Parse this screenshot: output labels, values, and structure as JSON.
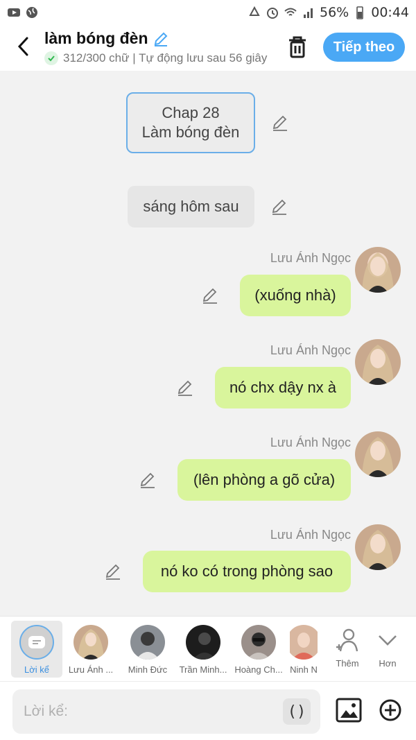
{
  "status_bar": {
    "battery": "56%",
    "time": "00:44"
  },
  "header": {
    "title": "làm bóng đèn",
    "subtitle": "312/300 chữ | Tự động lưu sau 56 giây",
    "next_label": "Tiếp theo"
  },
  "messages": {
    "chapter": {
      "line1": "Chap 28",
      "line2": "Làm bóng đèn"
    },
    "narration": "sáng hôm sau",
    "dialogues": [
      {
        "speaker": "Lưu Ánh Ngọc",
        "text": "(xuống nhà)"
      },
      {
        "speaker": "Lưu Ánh Ngọc",
        "text": "nó chx dậy nx à"
      },
      {
        "speaker": "Lưu Ánh Ngọc",
        "text": "(lên phòng a gõ cửa)"
      },
      {
        "speaker": "Lưu Ánh Ngọc",
        "text": "nó ko có trong phòng sao"
      }
    ]
  },
  "characters": [
    {
      "label": "Lời kể"
    },
    {
      "label": "Lưu Ánh ..."
    },
    {
      "label": "Minh Đức"
    },
    {
      "label": "Trần Minh..."
    },
    {
      "label": "Hoàng Ch..."
    },
    {
      "label": "Ninh N"
    }
  ],
  "actions": {
    "add_label": "Thêm",
    "more_label": "Hơn"
  },
  "composer": {
    "placeholder": "Lời kể:",
    "paren_label": "()"
  },
  "colors": {
    "accent": "#4aa8f5",
    "bubble": "#d9f59c",
    "narration_border": "#6aaee8"
  }
}
